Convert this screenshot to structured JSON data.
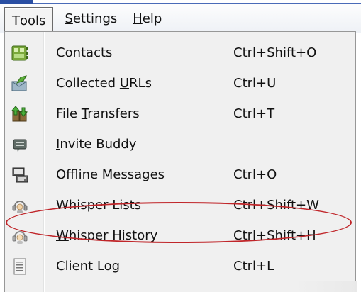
{
  "menubar": {
    "items": [
      {
        "pre": "",
        "accel": "T",
        "post": "ools",
        "active": true
      },
      {
        "pre": "",
        "accel": "S",
        "post": "ettings",
        "active": false
      },
      {
        "pre": "",
        "accel": "H",
        "post": "elp",
        "active": false
      }
    ]
  },
  "tools_menu": {
    "items": [
      {
        "pre": "Contacts",
        "accel": "",
        "post": "",
        "shortcut": "Ctrl+Shift+O",
        "icon": "contacts-icon"
      },
      {
        "pre": "Collected ",
        "accel": "U",
        "post": "RLs",
        "shortcut": "Ctrl+U",
        "icon": "collected-urls-icon"
      },
      {
        "pre": "File ",
        "accel": "T",
        "post": "ransfers",
        "shortcut": "Ctrl+T",
        "icon": "file-transfers-icon"
      },
      {
        "pre": "",
        "accel": "I",
        "post": "nvite Buddy",
        "shortcut": "",
        "icon": "invite-buddy-icon"
      },
      {
        "pre": "Offline Messages",
        "accel": "",
        "post": "",
        "shortcut": "Ctrl+O",
        "icon": "offline-messages-icon"
      },
      {
        "pre": "",
        "accel": "W",
        "post": "hisper Lists",
        "shortcut": "Ctrl+Shift+W",
        "icon": "whisper-lists-icon"
      },
      {
        "pre": "",
        "accel": "W",
        "post": "hisper History",
        "shortcut": "Ctrl+Shift+H",
        "icon": "whisper-history-icon"
      },
      {
        "pre": "Client ",
        "accel": "L",
        "post": "og",
        "shortcut": "Ctrl+L",
        "icon": "client-log-icon"
      }
    ]
  },
  "colors": {
    "highlight_ring": "#c0262a",
    "title_blue": "#2a4fa3"
  }
}
